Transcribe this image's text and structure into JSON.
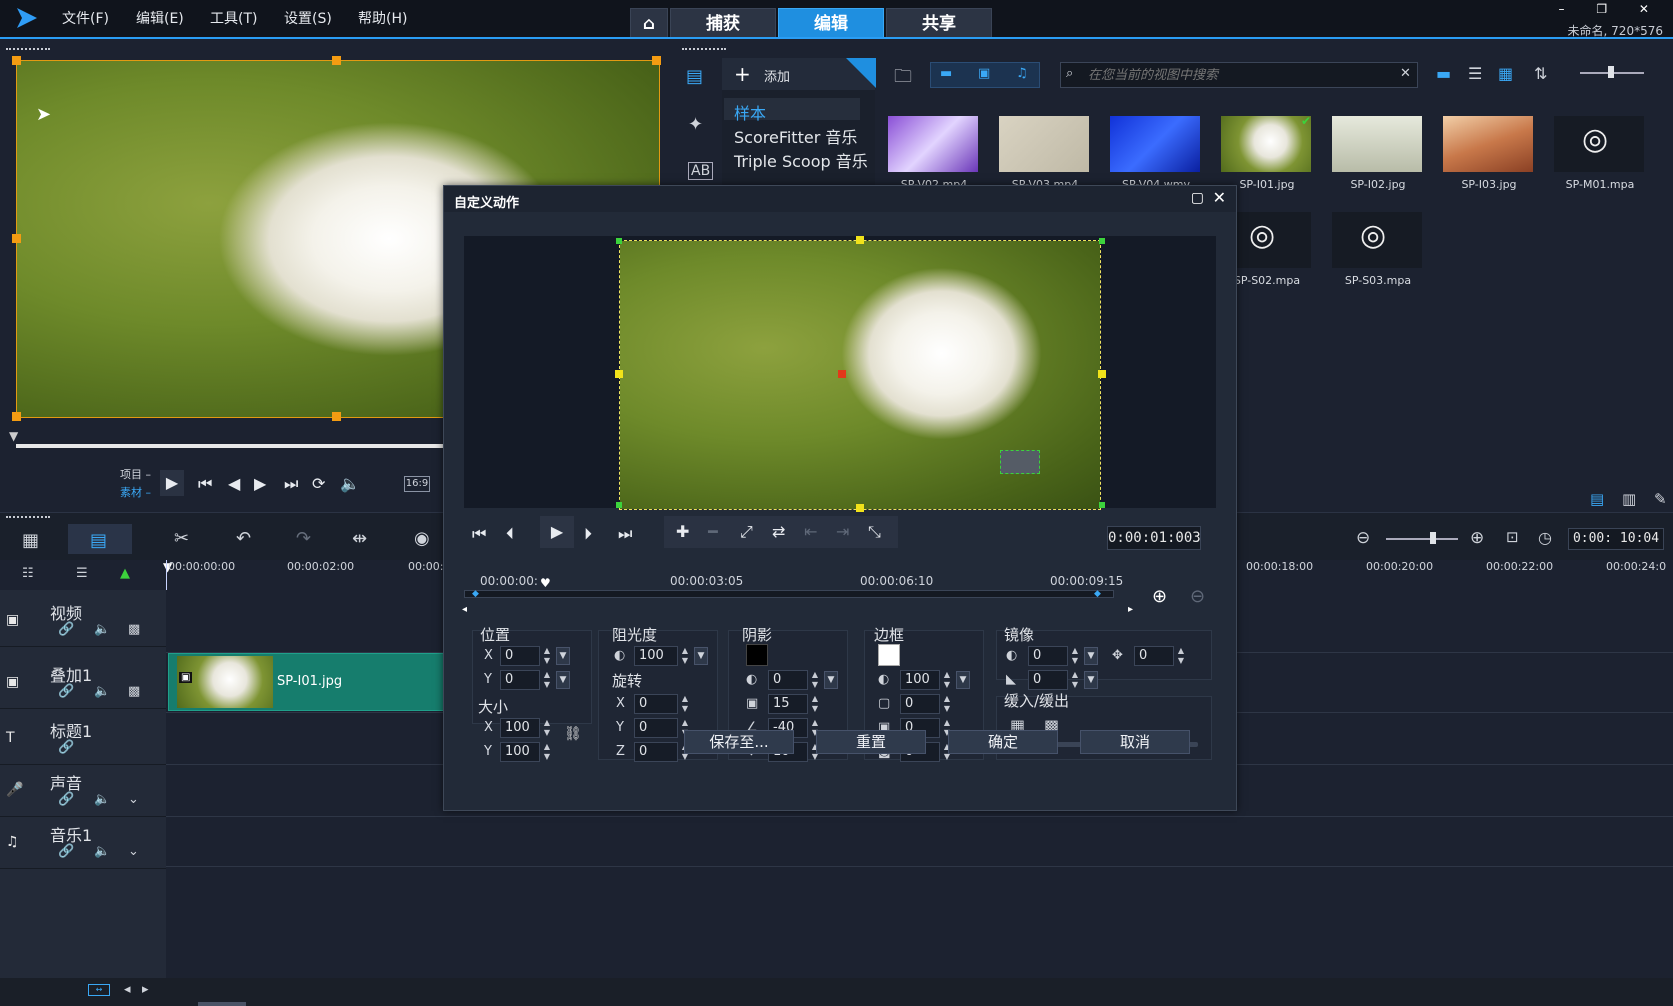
{
  "menus": [
    "文件(F)",
    "编辑(E)",
    "工具(T)",
    "设置(S)",
    "帮助(H)"
  ],
  "mode_tabs": {
    "capture": "捕获",
    "edit": "编辑",
    "share": "共享"
  },
  "project_info": "未命名, 720*576",
  "window_controls": "– ❐ ✕",
  "preview": {
    "project_label": "项目",
    "clip_label": "素材",
    "aspect": "16:9"
  },
  "library": {
    "add_label": "添加",
    "tree": [
      "样本",
      "ScoreFitter 音乐",
      "Triple Scoop 音乐"
    ],
    "search_placeholder": "在您当前的视图中搜索",
    "thumbs_row1": [
      "SP-V02.mp4",
      "SP-V03.mp4",
      "SP-V04.wmv",
      "SP-I01.jpg",
      "SP-I02.jpg",
      "SP-I03.jpg",
      "SP-M01.mpa"
    ],
    "thumbs_row2": [
      "SP-S02.mpa",
      "SP-S03.mpa"
    ]
  },
  "timeline": {
    "ruler": [
      "00:00:00:00",
      "00:00:02:00",
      "00:00:0",
      "00:00:18:00",
      "00:00:20:00",
      "00:00:22:00",
      "00:00:24:0"
    ],
    "timecode": "0:00: 10:04",
    "tracks": [
      "视频",
      "叠加1",
      "标题1",
      "声音",
      "音乐1"
    ],
    "clip_name": "SP-I01.jpg"
  },
  "dialog": {
    "title": "自定义动作",
    "timecode": "0:00:01:003",
    "ruler": [
      "00:00:00:",
      "00:00:03:05",
      "00:00:06:10",
      "00:00:09:15"
    ],
    "position": {
      "label": "位置",
      "x": "0",
      "y": "0"
    },
    "size": {
      "label": "大小",
      "x": "100",
      "y": "100"
    },
    "opacity": {
      "label": "阻光度",
      "value": "100"
    },
    "rotation": {
      "label": "旋转",
      "x": "0",
      "y": "0",
      "z": "0"
    },
    "shadow": {
      "label": "阴影",
      "v1": "0",
      "v2": "15",
      "v3": "-40",
      "v4": "10"
    },
    "border": {
      "label": "边框",
      "v1": "100",
      "v2": "0",
      "v3": "0",
      "v4": "0"
    },
    "mirror": {
      "label": "镜像",
      "v1": "0",
      "v2": "0",
      "v3": "0"
    },
    "ease": {
      "label": "缓入/缓出"
    },
    "buttons": {
      "save": "保存至...",
      "reset": "重置",
      "ok": "确定",
      "cancel": "取消"
    },
    "axis": {
      "x": "X",
      "y": "Y",
      "z": "Z"
    }
  },
  "colors": {
    "accent": "#1f8fe0",
    "clip": "#167d6d",
    "selection": "#e39a12"
  }
}
